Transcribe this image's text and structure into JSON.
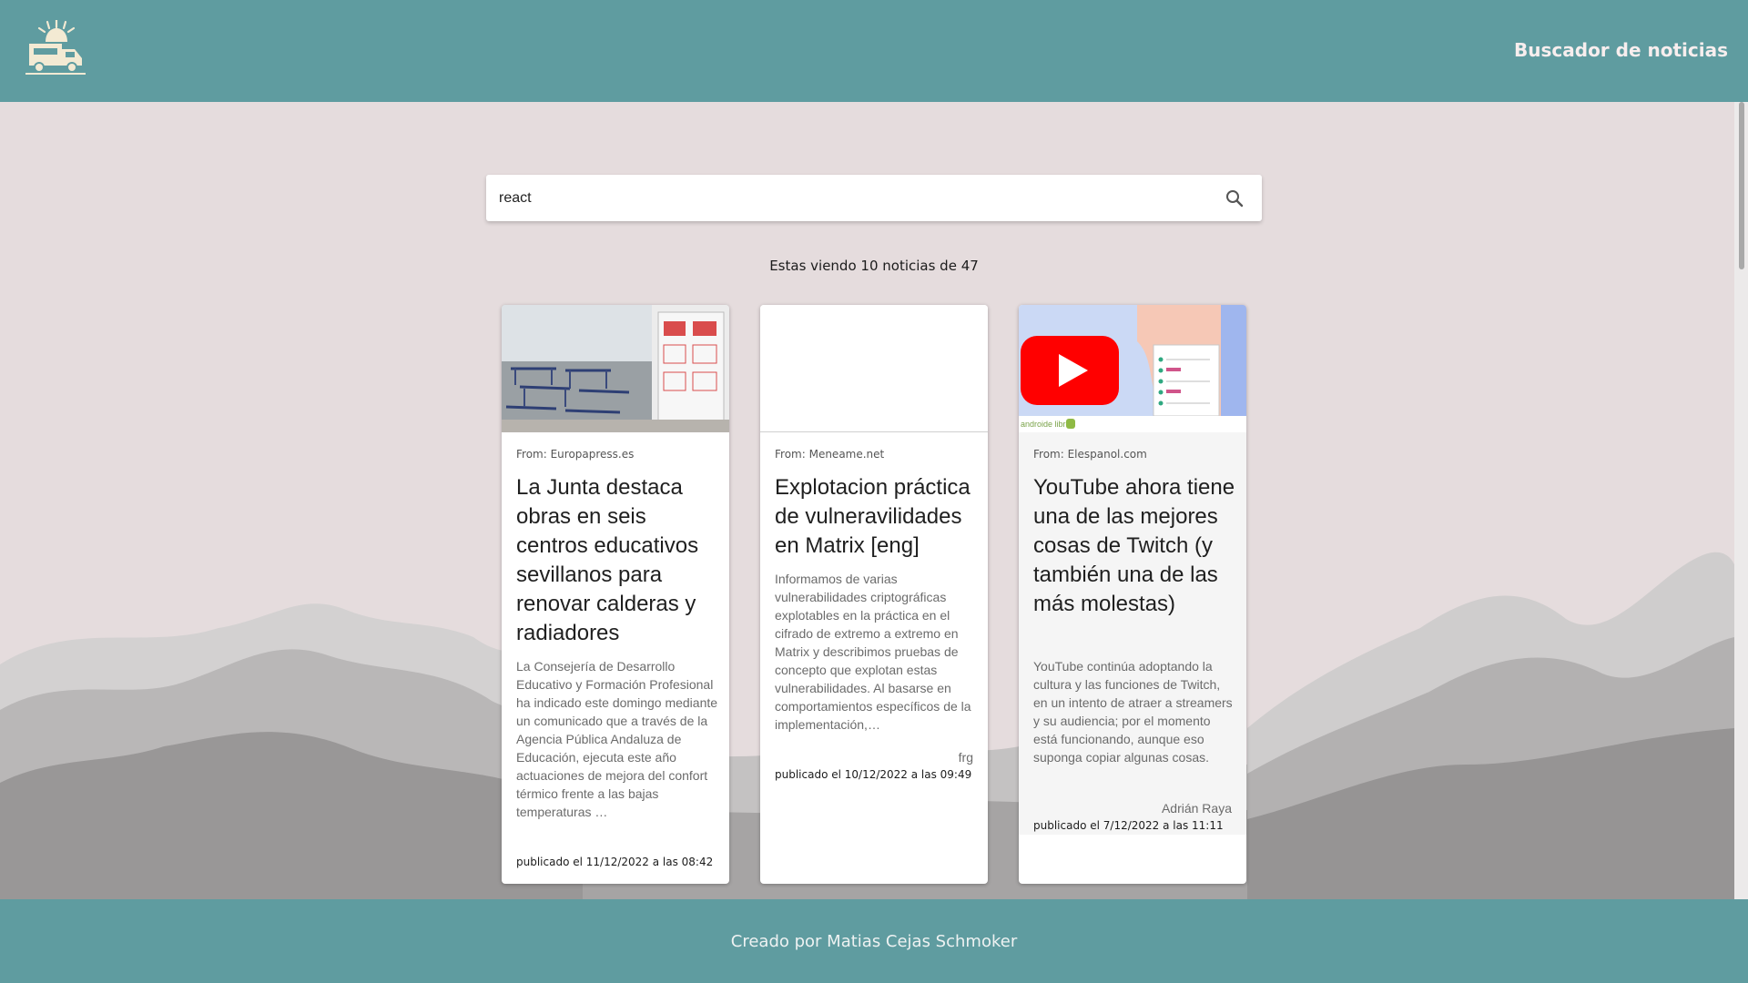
{
  "header": {
    "logo_icon": "food-truck-logo",
    "nav_title": "Buscador de noticias"
  },
  "search": {
    "value": "react",
    "icon": "search-icon"
  },
  "results_summary": "Estas viendo 10 noticias de 47",
  "cards": [
    {
      "source": "From: Europapress.es",
      "title": "La Junta destaca obras en seis centros educativos sevillanos para renovar calderas y radiadores",
      "description": "La Consejería de Desarrollo Educativo y Formación Profesional ha indicado este domingo mediante un comunicado que a través de la Agencia Pública Andaluza de Educación, ejecuta este año actuaciones de mejora del confort térmico frente a las bajas temperaturas …",
      "author": "",
      "date": "publicado el 11/12/2022 a las 08:42"
    },
    {
      "source": "From: Meneame.net",
      "title": "Explotacion práctica de vulneravilidades en Matrix [eng]",
      "description": "Informamos de varias vulnerabilidades criptográficas explotables en la práctica en el cifrado de extremo a extremo en Matrix y describimos pruebas de concepto que explotan estas vulnerabilidades. Al basarse en comportamientos específicos de la implementación,…",
      "author": "frg",
      "date": "publicado el 10/12/2022 a las 09:49"
    },
    {
      "source": "From: Elespanol.com",
      "title": "YouTube ahora tiene una de las mejores cosas de Twitch (y también una de las más molestas)",
      "description": "YouTube continúa adoptando la cultura y las funciones de Twitch, en un intento de atraer a streamers y su audiencia; por el momento está funcionando, aunque eso suponga copiar algunas cosas.",
      "author": "Adrián Raya",
      "date": "publicado el 7/12/2022 a las 11:11",
      "thumb_caption": "androide libre"
    }
  ],
  "footer": {
    "credit": "Creado por Matias Cejas Schmoker"
  },
  "colors": {
    "header_bg": "#5f9ca0",
    "page_bg": "#e5dcdd",
    "youtube_red": "#ff0000"
  }
}
